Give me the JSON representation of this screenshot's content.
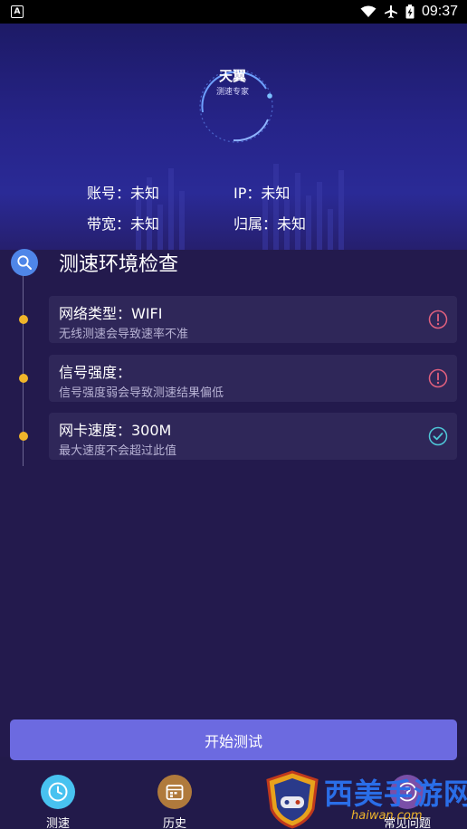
{
  "status_bar": {
    "notification_glyph": "A",
    "time": "09:37"
  },
  "header": {
    "dial_title": "天翼",
    "dial_subtitle": "测速专家",
    "account_label": "账号：未知",
    "ip_label": "IP：未知",
    "bandwidth_label": "带宽：未知",
    "region_label": "归属：未知"
  },
  "check": {
    "title": "测速环境检查",
    "items": [
      {
        "title": "网络类型：WIFI",
        "subtitle": "无线测速会导致速率不准",
        "status": "warning"
      },
      {
        "title": "信号强度：",
        "subtitle": "信号强度弱会导致测速结果偏低",
        "status": "warning"
      },
      {
        "title": "网卡速度：300M",
        "subtitle": "最大速度不会超过此值",
        "status": "ok"
      }
    ]
  },
  "start_button": {
    "label": "开始测试"
  },
  "nav": {
    "items": [
      {
        "label": "测速",
        "icon": "clock-icon"
      },
      {
        "label": "历史",
        "icon": "calendar-icon"
      },
      {
        "label": "常见问题",
        "icon": "question-icon"
      }
    ]
  },
  "watermark": {
    "text": "西美手游网",
    "sub": "haiwan.com"
  },
  "colors": {
    "background": "#221a4a",
    "accent_button": "#6c6ae0",
    "timeline_dot": "#f0b52a",
    "warning": "#e0607e",
    "ok": "#4fc8d8"
  }
}
